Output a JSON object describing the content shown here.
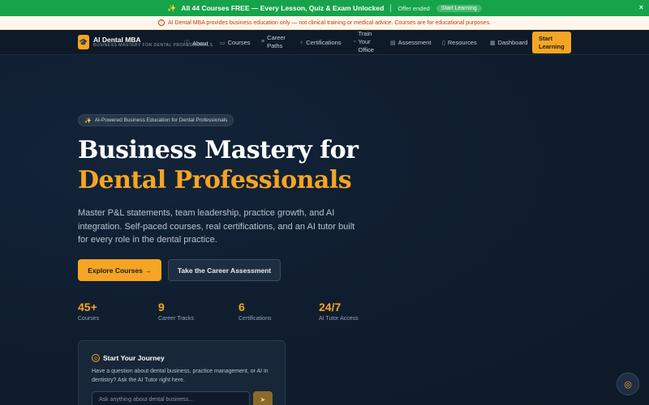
{
  "promo": {
    "icon": "sparkles-icon",
    "text": "All 44 Courses FREE — Every Lesson, Quiz & Exam Unlocked",
    "status": "Offer ended",
    "button": "Start Learning",
    "close": "×"
  },
  "notice": {
    "icon": "info-icon",
    "text": "AI Dental MBA provides business education only — not clinical training or medical advice. Courses are for educational purposes."
  },
  "nav": {
    "logo_name": "AI Dental MBA",
    "logo_sub": "BUSINESS MASTERY FOR DENTAL PROFESSIONALS",
    "items": [
      {
        "label": "About",
        "icon": "info-icon"
      },
      {
        "label": "Courses",
        "icon": "book-icon"
      },
      {
        "label": "Career Paths",
        "line1": "Career",
        "line2": "Paths",
        "icon": "route-icon"
      },
      {
        "label": "Certifications",
        "icon": "award-icon"
      },
      {
        "label": "Train Your Office",
        "line1": "Train",
        "line2": "Your",
        "line3": "Office",
        "icon": "users-icon"
      },
      {
        "label": "Assessment",
        "icon": "clipboard-icon"
      },
      {
        "label": "Resources",
        "icon": "file-icon"
      },
      {
        "label": "Dashboard",
        "icon": "grid-icon"
      }
    ],
    "cta_line1": "Start",
    "cta_line2": "Learning"
  },
  "hero": {
    "pill": "AI-Powered Business Education for Dental Professionals",
    "title_line1": "Business Mastery for",
    "title_line2": "Dental Professionals",
    "lede": "Master P&L statements, team leadership, practice growth, and AI integration. Self-paced courses, real certifications, and an AI tutor built for every role in the dental practice.",
    "primary_button": "Explore Courses →",
    "secondary_button": "Take the Career Assessment",
    "stats": [
      {
        "value": "45+",
        "label": "Courses"
      },
      {
        "value": "9",
        "label": "Career Tracks"
      },
      {
        "value": "6",
        "label": "Certifications"
      },
      {
        "value": "24/7",
        "label": "AI Tutor Access"
      }
    ]
  },
  "journey": {
    "title": "Start Your Journey",
    "description": "Have a question about dental business, practice management, or AI in dentistry? Ask the AI Tutor right here.",
    "input_placeholder": "Ask anything about dental business..."
  },
  "colors": {
    "accent": "#f5a524",
    "promo_green": "#16a34a",
    "notice_bg": "#fff7ed",
    "notice_text": "#c2410c",
    "background": "#0f1b2b"
  }
}
